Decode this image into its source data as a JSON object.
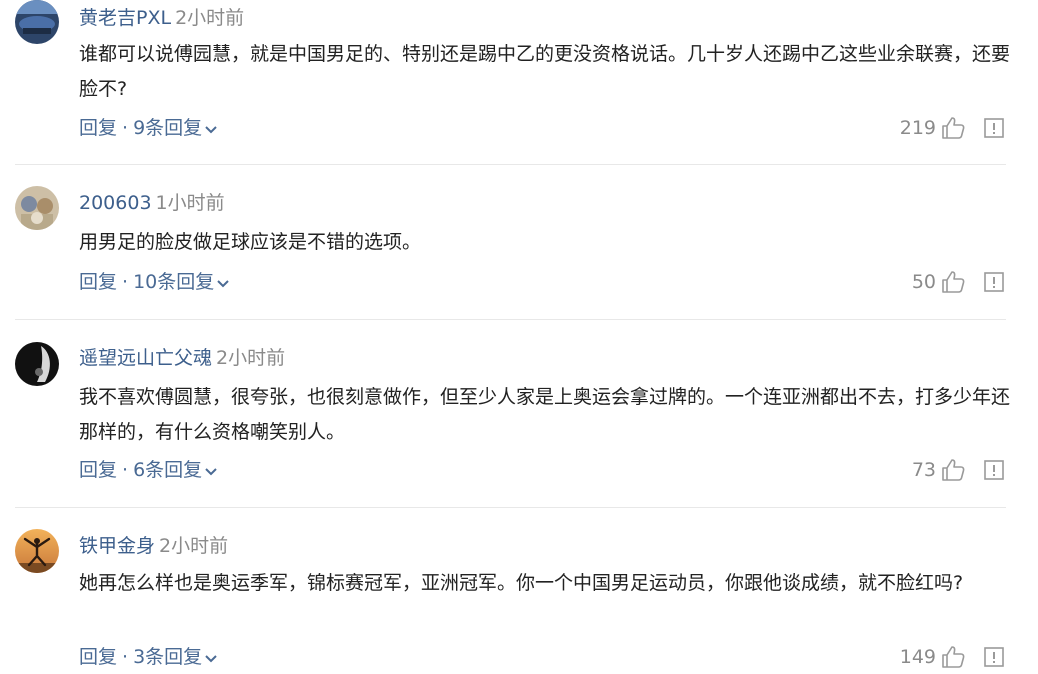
{
  "comments": [
    {
      "username": "黄老吉PXL",
      "time": "2小时前",
      "content": "谁都可以说傅园慧，就是中国男足的、特别还是踢中乙的更没资格说话。几十岁人还踢中乙这些业余联赛，还要脸不?",
      "reply_label": "回复",
      "replies_label": "9条回复",
      "likes": "219"
    },
    {
      "username": "200603",
      "time": "1小时前",
      "content": "用男足的脸皮做足球应该是不错的选项。",
      "reply_label": "回复",
      "replies_label": "10条回复",
      "likes": "50"
    },
    {
      "username": "遥望远山亡父魂",
      "time": "2小时前",
      "content": "我不喜欢傅圆慧，很夸张，也很刻意做作，但至少人家是上奥运会拿过牌的。一个连亚洲都出不去，打多少年还那样的，有什么资格嘲笑别人。",
      "reply_label": "回复",
      "replies_label": "6条回复",
      "likes": "73"
    },
    {
      "username": "铁甲金身",
      "time": "2小时前",
      "content": "她再怎么样也是奥运季军，锦标赛冠军，亚洲冠军。你一个中国男足运动员，你跟他谈成绩，就不脸红吗?",
      "reply_label": "回复",
      "replies_label": "3条回复",
      "likes": "149"
    }
  ],
  "separator": "·",
  "colors": {
    "username": "#3d5f8c",
    "link": "#4a6a94",
    "meta": "#8a8a8a",
    "text": "#222222",
    "divider": "#e8e8e8"
  },
  "icons": {
    "avatar": "user-avatar",
    "like": "thumbs-up-icon",
    "report": "report-icon",
    "expand": "chevron-down-icon"
  }
}
